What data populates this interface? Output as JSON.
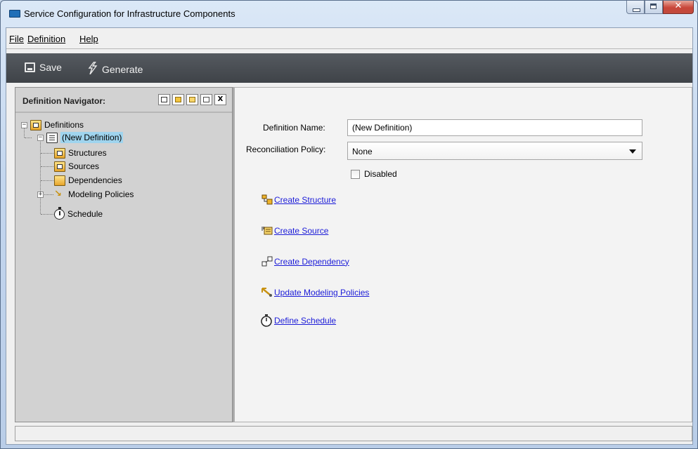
{
  "window": {
    "title": "Service Configuration for Infrastructure Components",
    "controls": [
      "minimize",
      "maximize",
      "close"
    ]
  },
  "menu": {
    "items": [
      {
        "label": "File",
        "accel": "F"
      },
      {
        "label": "Definition",
        "accel": "D"
      },
      {
        "label": "Help",
        "accel": "H"
      }
    ]
  },
  "toolbar": {
    "save_label": "Save",
    "generate_label": "Generate",
    "save_icon": "floppy-disk-icon",
    "generate_icon": "lightning-icon"
  },
  "navigator": {
    "title": "Definition Navigator:",
    "tool_icons": [
      "new-definition-icon",
      "add-structure-icon",
      "add-source-icon",
      "add-dependency-icon",
      "delete-icon"
    ],
    "close_glyph": "X",
    "tree": {
      "root": {
        "label": "Definitions",
        "expander": "−"
      },
      "definition": {
        "label": "(New Definition)",
        "expander": "−"
      },
      "children": [
        {
          "label": "Structures",
          "icon": "structures-icon"
        },
        {
          "label": "Sources",
          "icon": "sources-icon"
        },
        {
          "label": "Dependencies",
          "icon": "dependencies-icon"
        },
        {
          "label": "Modeling Policies",
          "icon": "modeling-policies-icon",
          "expander": "+"
        },
        {
          "label": "Schedule",
          "icon": "schedule-icon"
        }
      ]
    }
  },
  "form": {
    "definition_name_label": "Definition Name:",
    "definition_name_value": "(New Definition)",
    "reconciliation_label": "Reconciliation Policy:",
    "reconciliation_value": "None",
    "disabled_label": "Disabled",
    "disabled_checked": false
  },
  "actions": [
    {
      "label": "Create Structure",
      "icon": "structure-icon"
    },
    {
      "label": "Create Source",
      "icon": "source-icon"
    },
    {
      "label": "Create Dependency",
      "icon": "dependency-icon"
    },
    {
      "label": "Update Modeling Policies",
      "icon": "modeling-policy-icon"
    },
    {
      "label": "Define Schedule",
      "icon": "stopwatch-icon"
    }
  ],
  "status_bar": {
    "text": ""
  },
  "colors": {
    "toolbar_bg": "#484c51",
    "link": "#1c1cd8",
    "selection": "#9fd4ee",
    "nav_bg": "#d2d2d2"
  }
}
